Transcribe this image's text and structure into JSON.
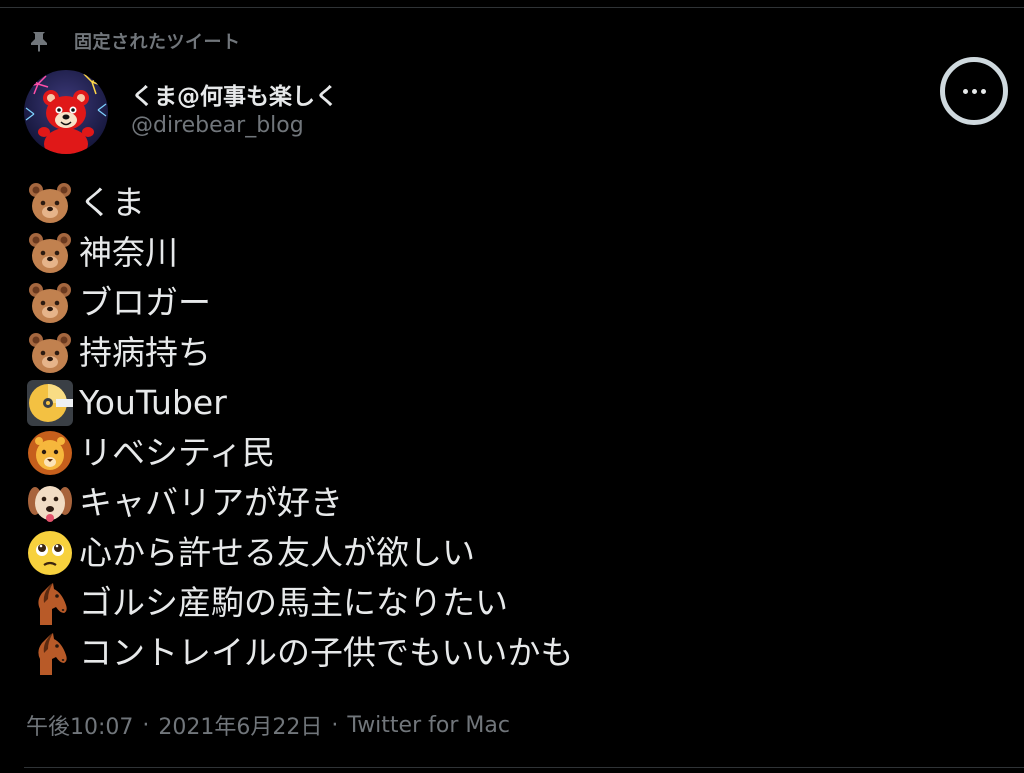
{
  "pinned": {
    "icon": "pin-icon",
    "label": "固定されたツイート"
  },
  "author": {
    "display_name": "くま@何事も楽しく",
    "handle": "@direbear_blog",
    "avatar": "bear-avatar"
  },
  "more_button": {
    "icon": "more-icon"
  },
  "tweet": {
    "lines": [
      {
        "emoji": "bear-face-icon",
        "text": "くま"
      },
      {
        "emoji": "bear-face-icon",
        "text": "神奈川"
      },
      {
        "emoji": "bear-face-icon",
        "text": "ブロガー"
      },
      {
        "emoji": "bear-face-icon",
        "text": "持病持ち"
      },
      {
        "emoji": "dvd-icon",
        "text": "YouTuber"
      },
      {
        "emoji": "lion-face-icon",
        "text": "リベシティ民"
      },
      {
        "emoji": "dog-face-icon",
        "text": "キャバリアが好き"
      },
      {
        "emoji": "pleading-face-icon",
        "text": "心から許せる友人が欲しい"
      },
      {
        "emoji": "horse-icon",
        "text": "ゴルシ産駒の馬主になりたい"
      },
      {
        "emoji": "horse-icon",
        "text": "コントレイルの子供でもいいかも"
      }
    ]
  },
  "meta": {
    "time": "午後10:07",
    "separator": "·",
    "date": "2021年6月22日",
    "source": "Twitter for Mac"
  },
  "colors": {
    "background": "#000000",
    "text_primary": "#e7e9ea",
    "text_secondary": "#71767b",
    "divider": "#2f3336"
  }
}
